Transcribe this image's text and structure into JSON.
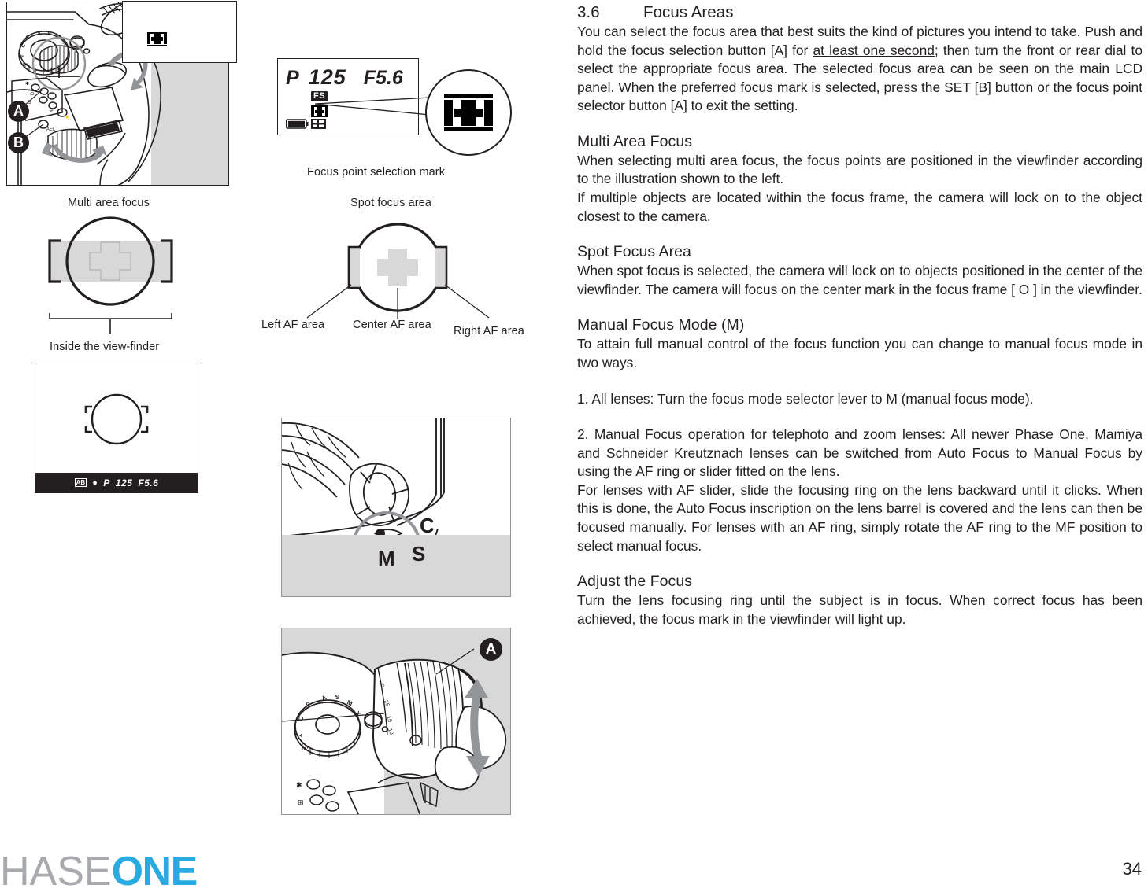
{
  "section": {
    "number": "3.6",
    "title": "Focus Areas",
    "intro_1": "You can select the focus area that best suits the kind of pictures you intend to take. Push and hold the focus selection button [A] for ",
    "intro_underlined": "at least one second",
    "intro_2": "; then turn the front or rear dial to select the appropriate focus area. The selected focus area can be seen on the main LCD panel. When the preferred focus mark is selected, press the SET [B] button or the focus point selector button [A] to exit the setting."
  },
  "multi_area": {
    "heading": "Multi Area Focus",
    "para_1": "When selecting multi area focus, the focus points are positioned in the viewfinder according to the illustration shown to the left.",
    "para_2": "If multiple objects are located within the focus frame, the camera will lock on to the object closest to the camera."
  },
  "spot_focus": {
    "heading": "Spot Focus Area",
    "para_1": "When spot focus is selected, the camera will lock on to objects positioned in the center of the viewfinder. The camera will focus on the center mark in the focus frame [ O ] in the viewfinder."
  },
  "manual_focus": {
    "heading": "Manual Focus Mode (M)",
    "para_1": "To attain full manual control of the focus function you can change to manual focus mode in two ways.",
    "item_1": "1. All lenses: Turn the focus mode selector lever to M (manual focus mode).",
    "item_2": "2. Manual Focus operation for telephoto and zoom lenses: All newer Phase One, Mamiya and Schneider Kreutznach lenses can be switched from Auto Focus to Manual Focus by using the AF ring or slider fitted on the lens.",
    "item_3": "For lenses with AF slider, slide the focusing ring on the lens backward until it clicks. When this is done, the Auto Focus inscription on the lens barrel is covered and the lens can then be focused manually. For lenses with an AF ring, simply rotate the AF ring to the MF position to select manual focus."
  },
  "adjust_focus": {
    "heading": "Adjust the Focus",
    "para_1": "Turn the lens focusing ring until the subject is in focus. When correct focus has been achieved, the focus mark in the viewfinder will light up."
  },
  "figures": {
    "camera_badge_a": "A",
    "camera_badge_b": "B",
    "lens_badge_a": "A",
    "lcd_caption": "Focus point selection mark",
    "lcd_mode": "P",
    "lcd_shutter": "125",
    "lcd_aperture": "F5.6",
    "lcd_fs": "FS",
    "multi_caption": "Multi area focus",
    "viewfinder_caption": "Inside the view-finder",
    "spot_caption": "Spot focus area",
    "left_af_caption": "Left AF area",
    "center_af_caption": "Center AF area",
    "right_af_caption": "Right AF area",
    "lens_sel_c": "C",
    "lens_sel_s": "S",
    "lens_sel_m": "M",
    "vf_mode": "P",
    "vf_shutter": "125",
    "vf_aperture": "F5.6",
    "vf_ab": "AB"
  },
  "footer": {
    "logo_grey": "HASE",
    "logo_blue": "ONE",
    "page_number": "34"
  },
  "colors": {
    "ink": "#231f20",
    "grey_fill": "#d8d8d8",
    "logo_grey": "#a7a9ac",
    "logo_blue": "#29abe2"
  }
}
